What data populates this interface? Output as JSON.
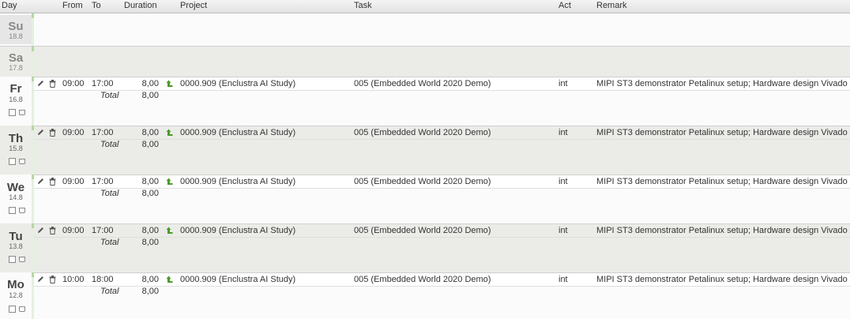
{
  "headers": {
    "day": "Day",
    "from": "From",
    "to": "To",
    "duration": "Duration",
    "project": "Project",
    "task": "Task",
    "act": "Act",
    "remark": "Remark"
  },
  "days": [
    {
      "name": "Su",
      "date": "18.8",
      "entries": []
    },
    {
      "name": "Sa",
      "date": "17.8",
      "entries": []
    },
    {
      "name": "Fr",
      "date": "16.8",
      "entries": [
        {
          "from": "09:00",
          "to": "17:00",
          "duration": "8,00",
          "project": "0000.909 (Enclustra AI Study)",
          "task": "005 (Embedded World 2020 Demo)",
          "act": "int",
          "remark": "MIPI ST3 demonstrator Petalinux setup; Hardware design Vivado"
        }
      ],
      "total_label": "Total",
      "total": "8,00"
    },
    {
      "name": "Th",
      "date": "15.8",
      "entries": [
        {
          "from": "09:00",
          "to": "17:00",
          "duration": "8,00",
          "project": "0000.909 (Enclustra AI Study)",
          "task": "005 (Embedded World 2020 Demo)",
          "act": "int",
          "remark": "MIPI ST3 demonstrator Petalinux setup; Hardware design Vivado"
        }
      ],
      "total_label": "Total",
      "total": "8,00"
    },
    {
      "name": "We",
      "date": "14.8",
      "entries": [
        {
          "from": "09:00",
          "to": "17:00",
          "duration": "8,00",
          "project": "0000.909 (Enclustra AI Study)",
          "task": "005 (Embedded World 2020 Demo)",
          "act": "int",
          "remark": "MIPI ST3 demonstrator Petalinux setup; Hardware design Vivado"
        }
      ],
      "total_label": "Total",
      "total": "8,00"
    },
    {
      "name": "Tu",
      "date": "13.8",
      "entries": [
        {
          "from": "09:00",
          "to": "17:00",
          "duration": "8,00",
          "project": "0000.909 (Enclustra AI Study)",
          "task": "005 (Embedded World 2020 Demo)",
          "act": "int",
          "remark": "MIPI ST3 demonstrator Petalinux setup; Hardware design Vivado"
        }
      ],
      "total_label": "Total",
      "total": "8,00"
    },
    {
      "name": "Mo",
      "date": "12.8",
      "entries": [
        {
          "from": "10:00",
          "to": "18:00",
          "duration": "8,00",
          "project": "0000.909 (Enclustra AI Study)",
          "task": "005 (Embedded World 2020 Demo)",
          "act": "int",
          "remark": "MIPI ST3 demonstrator Petalinux setup; Hardware design Vivado"
        }
      ],
      "total_label": "Total",
      "total": "8,00"
    }
  ],
  "icons": {
    "edit": "pencil-icon",
    "delete": "trash-icon",
    "project_link": "green-arrow-icon",
    "copy": "copy-icon",
    "coffee": "cup-icon"
  },
  "colors": {
    "alt_row": "#ebece8",
    "accent_green": "#4a9a2a",
    "header_bg": "#e8e8e8"
  }
}
